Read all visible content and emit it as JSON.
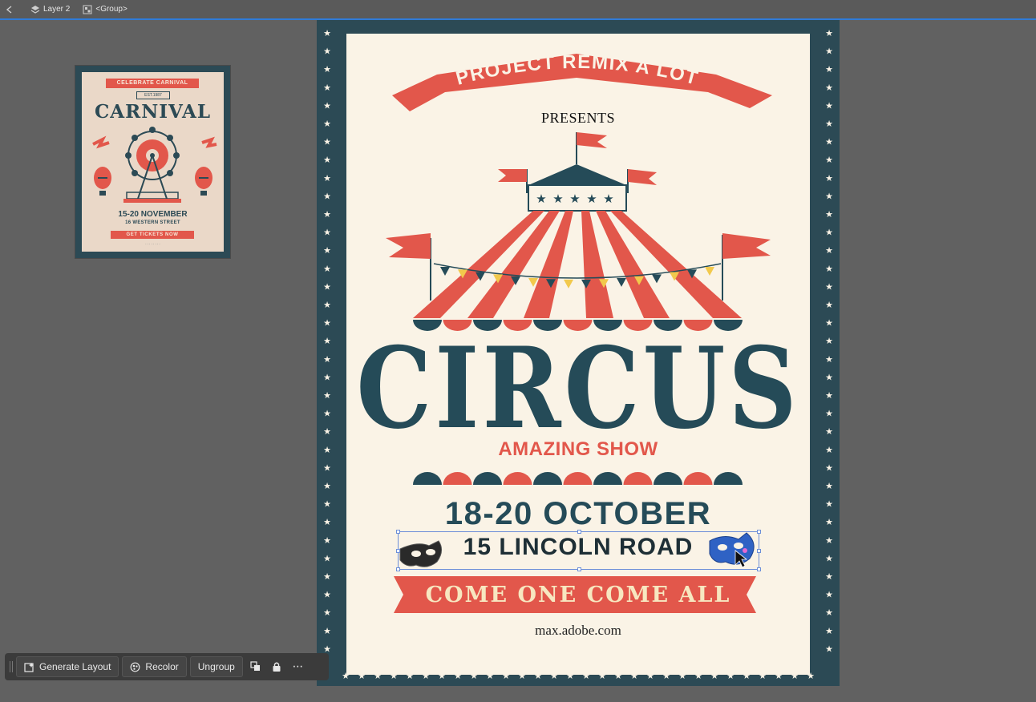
{
  "breadcrumb": {
    "layer_label": "Layer 2",
    "group_label": "<Group>"
  },
  "thumbnail": {
    "ribbon_text": "CELEBRATE CARNIVAL",
    "est_text": "EST.1987",
    "title": "CARNIVAL",
    "date_text": "15-20 NOVEMBER",
    "street_text": "16 WESTERN STREET",
    "ticket_text": "GET TICKETS NOW"
  },
  "poster": {
    "banner_text": "PROJECT REMIX A LOT",
    "presents": "PRESENTS",
    "title": "CIRCUS",
    "subtitle": "AMAZING SHOW",
    "dates": "18-20 OCTOBER",
    "address": "15 LINCOLN ROAD",
    "slogan": "COME ONE   COME ALL",
    "website": "max.adobe.com"
  },
  "toolbar": {
    "generate_layout": "Generate Layout",
    "recolor": "Recolor",
    "ungroup": "Ungroup",
    "more": "···"
  },
  "colors": {
    "navy": "#2c4a55",
    "red": "#e2574b",
    "cream": "#faf3e6",
    "selection": "#6c8ed8"
  }
}
